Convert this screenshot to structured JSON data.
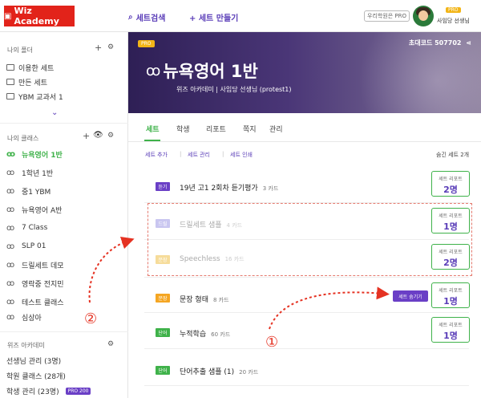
{
  "topbar": {
    "logo_text": "Wiz Academy",
    "search_label": "세트검색",
    "create_label": "+ 세트 만들기",
    "pro_pill": "우리학원은 PRO",
    "user_badge": "PRO",
    "user_name": "사임당 선생님"
  },
  "sidebar": {
    "folders_heading": "나의 폴더",
    "folders": [
      {
        "label": "이용한 세트"
      },
      {
        "label": "만든 세트"
      },
      {
        "label": "YBM 교과서 1"
      }
    ],
    "classes_heading": "나의 클래스",
    "classes": [
      {
        "label": "뉴욕영어 1반",
        "active": true
      },
      {
        "label": "1학년 1반"
      },
      {
        "label": "중1 YBM"
      },
      {
        "label": "뉴욕영어 A반"
      },
      {
        "label": "7 Class"
      },
      {
        "label": "SLP 01"
      },
      {
        "label": "드릴세트 데모"
      },
      {
        "label": "영락중 전지민"
      },
      {
        "label": "테스트 클래스"
      },
      {
        "label": "심상아"
      }
    ],
    "academy_heading": "위즈 아카데미",
    "academy_items": [
      {
        "label": "선생님 관리 (3명)"
      },
      {
        "label": "학원 클래스 (28개)"
      },
      {
        "label": "학생 관리 (23명)",
        "badge": "PRO 200"
      }
    ]
  },
  "banner": {
    "pro_badge": "PRO",
    "invite_code": "초대코드 507702",
    "class_name": "뉴욕영어 1반",
    "subtitle": "위즈 아카데미 | 사임당 선생님 (protest1)"
  },
  "tabs": [
    {
      "label": "세트"
    },
    {
      "label": "학생"
    },
    {
      "label": "리포트"
    },
    {
      "label": "쪽지"
    },
    {
      "label": "관리"
    }
  ],
  "actions": {
    "add": "세트 추가",
    "manage": "세트 관리",
    "print": "세트 인쇄",
    "hidden": "숨긴 세트 2개"
  },
  "sets": [
    {
      "tag": "듣기",
      "tag_color": "#6a3fc6",
      "title": "19년 고1 2회차 듣기평가",
      "count": "3 카드",
      "report_label": "세트 리포트",
      "report_value": "2명",
      "faded": false
    },
    {
      "tag": "드릴",
      "tag_color": "#c9c6f0",
      "title": "드릴세트 샘플",
      "count": "4 카드",
      "report_label": "세트 리포트",
      "report_value": "1명",
      "faded": true
    },
    {
      "tag": "문장",
      "tag_color": "#f6dc9a",
      "title": "Speechless",
      "count": "16 카드",
      "report_label": "세트 리포트",
      "report_value": "2명",
      "faded": true
    },
    {
      "tag": "문장",
      "tag_color": "#f5a623",
      "title": "문장 형태",
      "count": "8 카드",
      "report_label": "세트 리포트",
      "report_value": "1명",
      "faded": false,
      "hide_button": "세트 숨기기"
    },
    {
      "tag": "단어",
      "tag_color": "#3fb24a",
      "title": "누적학습",
      "count": "60 카드",
      "report_label": "세트 리포트",
      "report_value": "1명",
      "faded": false
    },
    {
      "tag": "단어",
      "tag_color": "#3fb24a",
      "title": "단어추출 샘플 (1)",
      "count": "20 카드",
      "report_label": "",
      "report_value": "",
      "faded": false
    }
  ],
  "annotations": {
    "marker_one": "①",
    "marker_two": "②",
    "color": "#e53222"
  }
}
